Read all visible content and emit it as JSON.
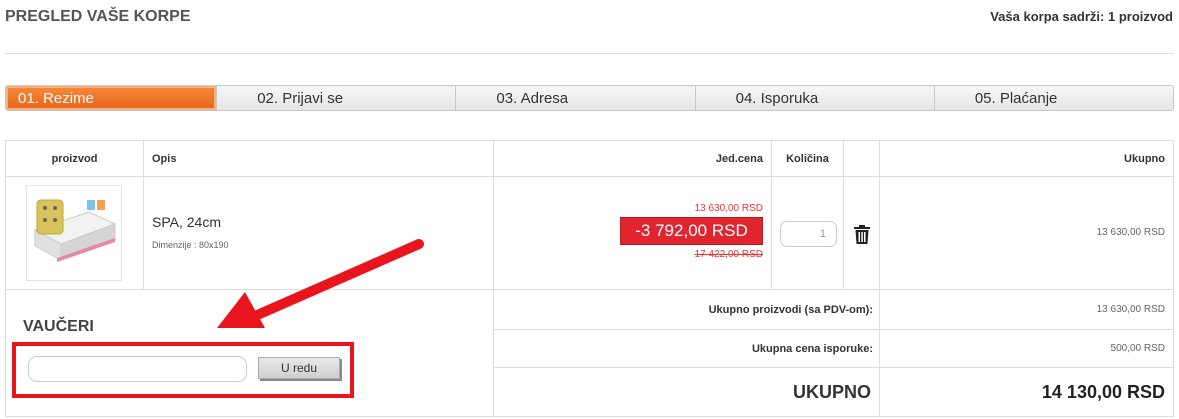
{
  "header": {
    "title": "PREGLED VAŠE KORPE",
    "cart_summary": "Vaša korpa sadrži: 1 proizvod"
  },
  "steps": [
    {
      "label": "01. Rezime",
      "active": true
    },
    {
      "label": "02. Prijavi se",
      "active": false
    },
    {
      "label": "03. Adresa",
      "active": false
    },
    {
      "label": "04. Isporuka",
      "active": false
    },
    {
      "label": "05. Plaćanje",
      "active": false
    }
  ],
  "table": {
    "columns": {
      "product": "proizvod",
      "description": "Opis",
      "unit_price": "Jed.cena",
      "quantity": "Količina",
      "total": "Ukupno"
    },
    "items": [
      {
        "name": "SPA, 24cm",
        "dimensions": "Dimenzije : 80x190",
        "price_current": "13 630,00 RSD",
        "discount": "-3 792,00 RSD",
        "price_original": "17 422,00 RSD",
        "quantity": "1",
        "subtotal": "13 630,00 RSD"
      }
    ]
  },
  "voucher": {
    "title": "VAUČERI",
    "input_placeholder": "",
    "button_label": "U redu"
  },
  "summary": {
    "products_label": "Ukupno proizvodi (sa PDV-om):",
    "products_value": "13 630,00 RSD",
    "shipping_label": "Ukupna cena isporuke:",
    "shipping_value": "500,00 RSD",
    "total_label": "UKUPNO",
    "total_value": "14 130,00 RSD"
  },
  "colors": {
    "accent_orange": "#e8641b",
    "discount_red": "#e0252e",
    "annotation_red": "#e8161c"
  }
}
